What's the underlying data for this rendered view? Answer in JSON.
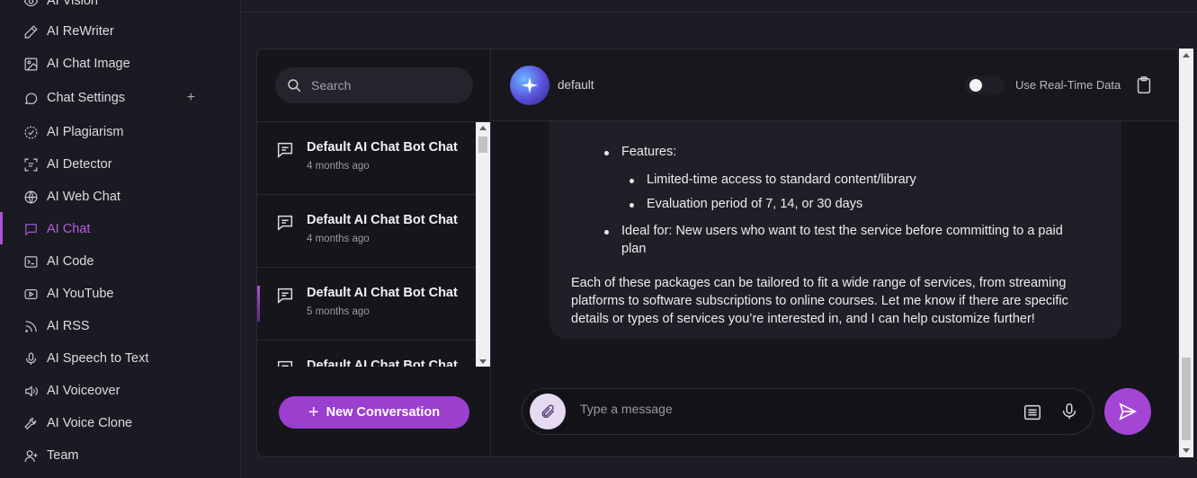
{
  "sidebar": {
    "items": [
      {
        "label": "AI Vision",
        "icon": "eye-icon"
      },
      {
        "label": "AI ReWriter",
        "icon": "pen-icon"
      },
      {
        "label": "AI Chat Image",
        "icon": "image-icon"
      },
      {
        "label": "Chat Settings",
        "icon": "chat-bubble-icon",
        "extra": "+"
      },
      {
        "label": "AI Plagiarism",
        "icon": "badge-check-icon"
      },
      {
        "label": "AI Detector",
        "icon": "scan-icon"
      },
      {
        "label": "AI Web Chat",
        "icon": "globe-icon"
      },
      {
        "label": "AI Chat",
        "icon": "message-icon",
        "active": true
      },
      {
        "label": "AI Code",
        "icon": "terminal-icon"
      },
      {
        "label": "AI YouTube",
        "icon": "youtube-icon"
      },
      {
        "label": "AI RSS",
        "icon": "rss-icon"
      },
      {
        "label": "AI Speech to Text",
        "icon": "microphone-icon"
      },
      {
        "label": "AI Voiceover",
        "icon": "speaker-icon"
      },
      {
        "label": "AI Voice Clone",
        "icon": "wrench-icon"
      },
      {
        "label": "Team",
        "icon": "user-plus-icon"
      }
    ],
    "accent": "#b14fd8"
  },
  "conversations": {
    "search_placeholder": "Search",
    "items": [
      {
        "title": "Default AI Chat Bot Chat",
        "time": "4 months ago"
      },
      {
        "title": "Default AI Chat Bot Chat",
        "time": "4 months ago"
      },
      {
        "title": "Default AI Chat Bot Chat",
        "time": "5 months ago",
        "selected": true
      },
      {
        "title": "Default AI Chat Bot Chat",
        "time": ""
      }
    ],
    "new_button": "New Conversation",
    "new_button_plus": "+"
  },
  "chat": {
    "bot_name": "default",
    "realtime_label": "Use Real-Time Data",
    "realtime_enabled": false,
    "message": {
      "features_label": "Features:",
      "features": [
        "Limited-time access to standard content/library",
        "Evaluation period of 7, 14, or 30 days"
      ],
      "ideal_for_line1": "Ideal for: New users who want to test the service before committing to a paid",
      "ideal_for_line2": "plan",
      "closing_line1": "Each of these packages can be tailored to fit a wide range of services, from streaming",
      "closing_line2": "platforms to software subscriptions to online courses. Let me know if there are specific",
      "closing_line3": "details or types of services you’re interested in, and I can help customize further!"
    },
    "input_placeholder": "Type a message"
  },
  "colors": {
    "background": "#1c1c24",
    "panel": "#15151b",
    "accent": "#a545d6"
  }
}
